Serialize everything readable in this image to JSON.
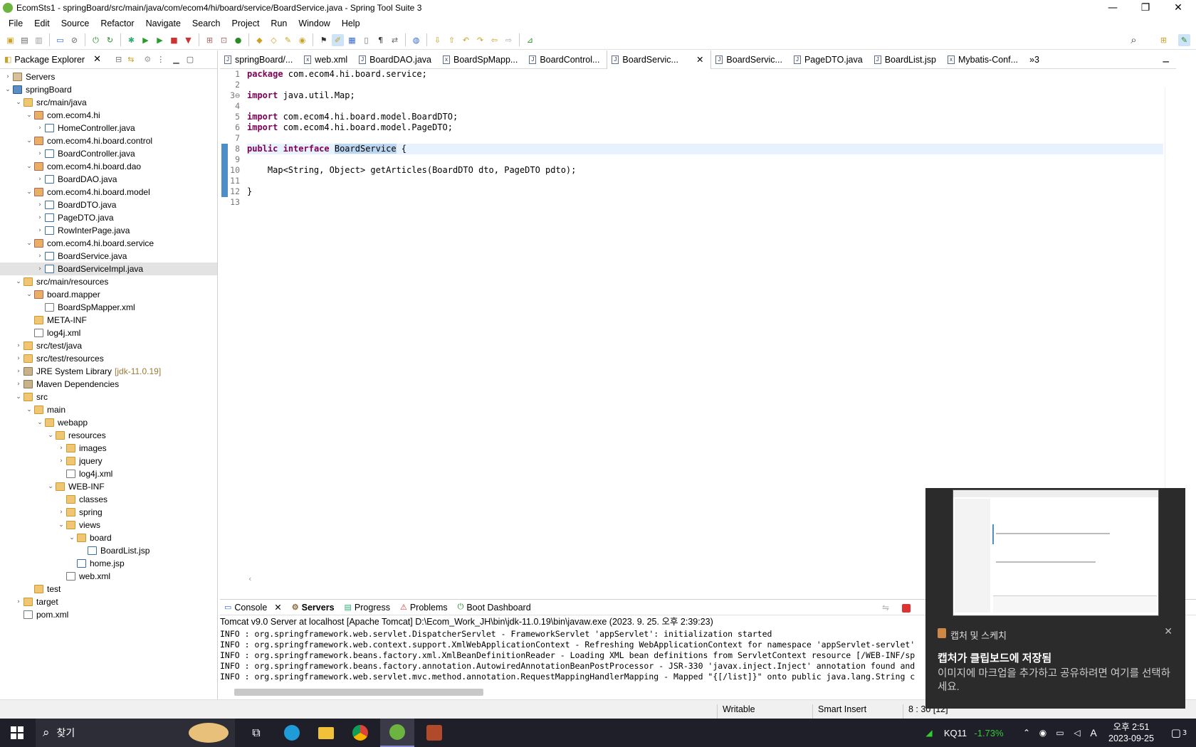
{
  "window": {
    "title": "EcomSts1 - springBoard/src/main/java/com/ecom4/hi/board/service/BoardService.java - Spring Tool Suite 3"
  },
  "menu": [
    "File",
    "Edit",
    "Source",
    "Refactor",
    "Navigate",
    "Search",
    "Project",
    "Run",
    "Window",
    "Help"
  ],
  "package_explorer": {
    "title": "Package Explorer",
    "items": [
      {
        "label": "Servers",
        "arrow": "›"
      },
      {
        "label": "springBoard",
        "arrow": "⌄"
      },
      {
        "label": "src/main/java",
        "arrow": "⌄"
      },
      {
        "label": "com.ecom4.hi",
        "arrow": "⌄"
      },
      {
        "label": "HomeController.java",
        "arrow": "›"
      },
      {
        "label": "com.ecom4.hi.board.control",
        "arrow": "⌄"
      },
      {
        "label": "BoardController.java",
        "arrow": "›"
      },
      {
        "label": "com.ecom4.hi.board.dao",
        "arrow": "⌄"
      },
      {
        "label": "BoardDAO.java",
        "arrow": "›"
      },
      {
        "label": "com.ecom4.hi.board.model",
        "arrow": "⌄"
      },
      {
        "label": "BoardDTO.java",
        "arrow": "›"
      },
      {
        "label": "PageDTO.java",
        "arrow": "›"
      },
      {
        "label": "RowInterPage.java",
        "arrow": "›"
      },
      {
        "label": "com.ecom4.hi.board.service",
        "arrow": "⌄"
      },
      {
        "label": "BoardService.java",
        "arrow": "›"
      },
      {
        "label": "BoardServiceImpl.java",
        "arrow": "›"
      },
      {
        "label": "src/main/resources",
        "arrow": "⌄"
      },
      {
        "label": "board.mapper",
        "arrow": "⌄"
      },
      {
        "label": "BoardSpMapper.xml",
        "arrow": ""
      },
      {
        "label": "META-INF",
        "arrow": ""
      },
      {
        "label": "log4j.xml",
        "arrow": ""
      },
      {
        "label": "src/test/java",
        "arrow": "›"
      },
      {
        "label": "src/test/resources",
        "arrow": "›"
      },
      {
        "label": "JRE System Library",
        "arrow": "›",
        "extra": "[jdk-11.0.19]"
      },
      {
        "label": "Maven Dependencies",
        "arrow": "›"
      },
      {
        "label": "src",
        "arrow": "⌄"
      },
      {
        "label": "main",
        "arrow": "⌄"
      },
      {
        "label": "webapp",
        "arrow": "⌄"
      },
      {
        "label": "resources",
        "arrow": "⌄"
      },
      {
        "label": "images",
        "arrow": "›"
      },
      {
        "label": "jquery",
        "arrow": "›"
      },
      {
        "label": "log4j.xml",
        "arrow": ""
      },
      {
        "label": "WEB-INF",
        "arrow": "⌄"
      },
      {
        "label": "classes",
        "arrow": ""
      },
      {
        "label": "spring",
        "arrow": "›"
      },
      {
        "label": "views",
        "arrow": "⌄"
      },
      {
        "label": "board",
        "arrow": "⌄"
      },
      {
        "label": "BoardList.jsp",
        "arrow": ""
      },
      {
        "label": "home.jsp",
        "arrow": ""
      },
      {
        "label": "web.xml",
        "arrow": ""
      },
      {
        "label": "test",
        "arrow": ""
      },
      {
        "label": "target",
        "arrow": "›"
      },
      {
        "label": "pom.xml",
        "arrow": ""
      }
    ]
  },
  "editor": {
    "tabs": [
      "springBoard/...",
      "web.xml",
      "BoardDAO.java",
      "BoardSpMapp...",
      "BoardControl...",
      "BoardServic...",
      "BoardServic...",
      "PageDTO.java",
      "BoardList.jsp",
      "Mybatis-Conf..."
    ],
    "overflow": "»3",
    "line_numbers": [
      "1",
      "2",
      "3⊖",
      "4",
      "5",
      "6",
      "7",
      "8",
      "9",
      "10",
      "11",
      "12",
      "13"
    ],
    "code": {
      "l1a": "package",
      "l1b": " com.ecom4.hi.board.service;",
      "l3a": "import",
      "l3b": " java.util.Map;",
      "l5a": "import",
      "l5b": " com.ecom4.hi.board.model.BoardDTO;",
      "l6a": "import",
      "l6b": " com.ecom4.hi.board.model.PageDTO;",
      "l8a": "public",
      "l8b": "interface",
      "l8c": "BoardService",
      "l8d": " {",
      "l10": "    Map<String, Object> getArticles(BoardDTO dto, PageDTO pdto);",
      "l12": "}"
    }
  },
  "bottom": {
    "tabs": [
      "Console",
      "Servers",
      "Progress",
      "Problems",
      "Boot Dashboard"
    ],
    "description": "Tomcat v9.0 Server at localhost [Apache Tomcat] D:\\Ecom_Work_JH\\bin\\jdk-11.0.19\\bin\\javaw.exe  (2023. 9. 25. 오후 2:39:23)",
    "lines": [
      "INFO : org.springframework.web.servlet.DispatcherServlet - FrameworkServlet 'appServlet': initialization started",
      "INFO : org.springframework.web.context.support.XmlWebApplicationContext - Refreshing WebApplicationContext for namespace 'appServlet-servlet'",
      "INFO : org.springframework.beans.factory.xml.XmlBeanDefinitionReader - Loading XML bean definitions from ServletContext resource [/WEB-INF/sp",
      "INFO : org.springframework.beans.factory.annotation.AutowiredAnnotationBeanPostProcessor - JSR-330 'javax.inject.Inject' annotation found and",
      "INFO : org.springframework.web.servlet.mvc.method.annotation.RequestMappingHandlerMapping - Mapped \"{[/list]}\" onto public java.lang.String c"
    ]
  },
  "status": {
    "writable": "Writable",
    "insert": "Smart Insert",
    "position": "8 : 30 [12]"
  },
  "toast": {
    "app": "캡처 및 스케치",
    "title": "캡처가 클립보드에 저장됨",
    "body": "이미지에 마크업을 추가하고 공유하려면 여기를 선택하세요."
  },
  "taskbar": {
    "search": "찾기",
    "stock_name": "KQ11",
    "stock_change": "-1.73%",
    "time": "오후 2:51",
    "date": "2023-09-25",
    "notif_count": "3",
    "ime": "A"
  }
}
